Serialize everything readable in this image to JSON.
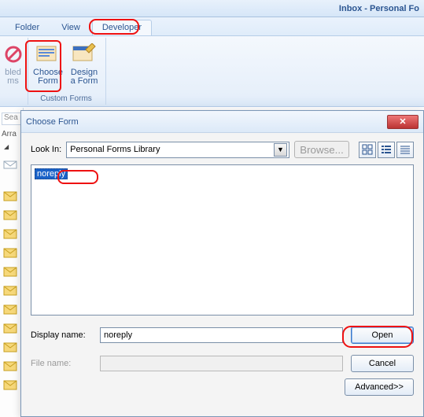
{
  "title": "Inbox - Personal Fo",
  "ribbon": {
    "tabs": [
      "Folder",
      "View",
      "Developer"
    ],
    "active_tab": 2,
    "group1": {
      "label": "",
      "btn": "bled\nms"
    },
    "group2": {
      "label": "Custom Forms",
      "choose": "Choose\nForm",
      "design": "Design\na Form"
    }
  },
  "mail": {
    "search_prefix": "Sea",
    "arrange": "Arra"
  },
  "dialog": {
    "title": "Choose Form",
    "lookin_label": "Look In:",
    "lookin_value": "Personal Forms Library",
    "browse": "Browse...",
    "items": [
      "noreply"
    ],
    "display_label": "Display name:",
    "display_value": "noreply",
    "file_label": "File name:",
    "file_value": "",
    "open": "Open",
    "cancel": "Cancel",
    "advanced": "Advanced>>"
  }
}
